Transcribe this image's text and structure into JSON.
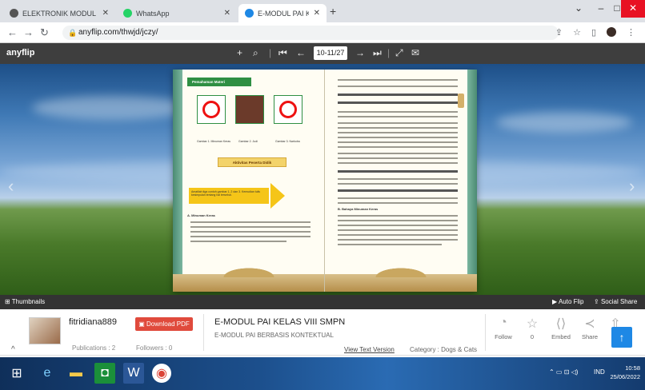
{
  "browser": {
    "tabs": [
      {
        "title": "ELEKTRONIK MODUL BERBASIS",
        "icon": "anyflip-favicon",
        "active": false
      },
      {
        "title": "WhatsApp",
        "icon": "whatsapp-icon",
        "active": false
      },
      {
        "title": "E-MODUL PAI KELAS VIII SMPN",
        "icon": "anyflip-favicon",
        "active": true
      }
    ],
    "url": "anyflip.com/thwjd/jczy/"
  },
  "toolbar": {
    "logo": "anyflip",
    "page_indicator": "10-11/27"
  },
  "book": {
    "left_page": {
      "section_title": "Pemahaman Materi",
      "captions": [
        "Gambar 1. Minuman Keras",
        "Gambar 2. Judi",
        "Gambar 3. Narkoba"
      ],
      "activity_banner": "Aktivitas Peserta Didik",
      "activity_text": "Amatilah tiga contoh gambar 1, 2 dan 3. Kemudian tulis kesimpulan tentang hal tersebut.",
      "heading": "A. Minuman Keras"
    },
    "right_page": {
      "heading": "B. Bahaya Minuman Keras"
    }
  },
  "viewer_bar": {
    "thumbnails": "Thumbnails",
    "auto_flip": "Auto Flip",
    "social_share": "Social Share"
  },
  "publisher": {
    "name": "fitridiana889",
    "download_label": "Download PDF",
    "publications": "Publications : 2",
    "followers": "Followers : 0"
  },
  "publication": {
    "title": "E-MODUL PAI KELAS VIII SMPN",
    "subtitle": "E-MODUL PAI BERBASIS KONTEKTUAL",
    "view_text": "View Text Version",
    "category": "Category : Dogs & Cats"
  },
  "actions": [
    {
      "label": "Follow",
      "icon": "rss-icon"
    },
    {
      "label": "0",
      "icon": "star-icon"
    },
    {
      "label": "Embed",
      "icon": "embed-icon"
    },
    {
      "label": "Share",
      "icon": "share-icon"
    },
    {
      "label": "Up",
      "icon": "upload-icon"
    }
  ],
  "taskbar": {
    "lang": "IND",
    "time": "10:58",
    "date": "25/06/2022"
  },
  "colors": {
    "anyflip_bar": "#3e3e3e",
    "download_red": "#e04a3c",
    "accent_blue": "#1e88e5",
    "book_green": "#2f8f43"
  }
}
